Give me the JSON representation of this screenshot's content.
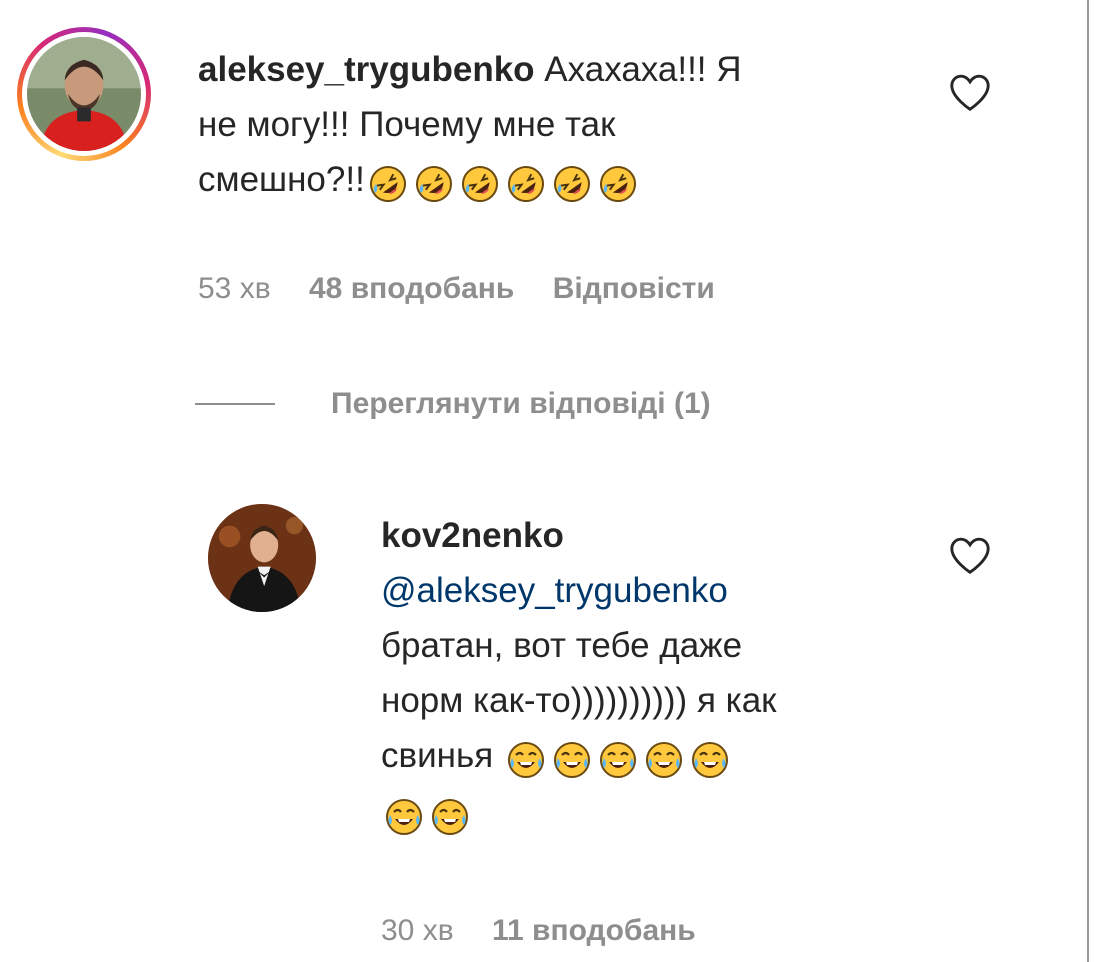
{
  "comments": [
    {
      "username": "aleksey_trygubenko",
      "text_line1": "Ахахаха!!! Я",
      "text_line2": "не могу!!! Почему мне так",
      "text_line3": "смешно?!!",
      "emojis": [
        "rolling-on-floor-laughing",
        "rolling-on-floor-laughing",
        "rolling-on-floor-laughing",
        "rolling-on-floor-laughing",
        "rolling-on-floor-laughing",
        "rolling-on-floor-laughing"
      ],
      "time": "53 хв",
      "likes": "48 вподобань",
      "reply_label": "Відповісти"
    }
  ],
  "view_replies": "Переглянути відповіді (1)",
  "reply": {
    "username": "kov2nenko",
    "mention": "@aleksey_trygubenko",
    "text_line1": "братан, вот тебе даже",
    "text_line2": "норм как-то)))))))))) я как",
    "text_line3": "свинья",
    "emojis": [
      "face-with-tears-of-joy",
      "face-with-tears-of-joy",
      "face-with-tears-of-joy",
      "face-with-tears-of-joy",
      "face-with-tears-of-joy",
      "face-with-tears-of-joy",
      "face-with-tears-of-joy"
    ],
    "time": "30 хв",
    "likes": "11 вподобань"
  },
  "colors": {
    "text": "#262626",
    "secondary": "#8e8e8e",
    "mention": "#00376b",
    "emoji": "#ffc83d"
  }
}
